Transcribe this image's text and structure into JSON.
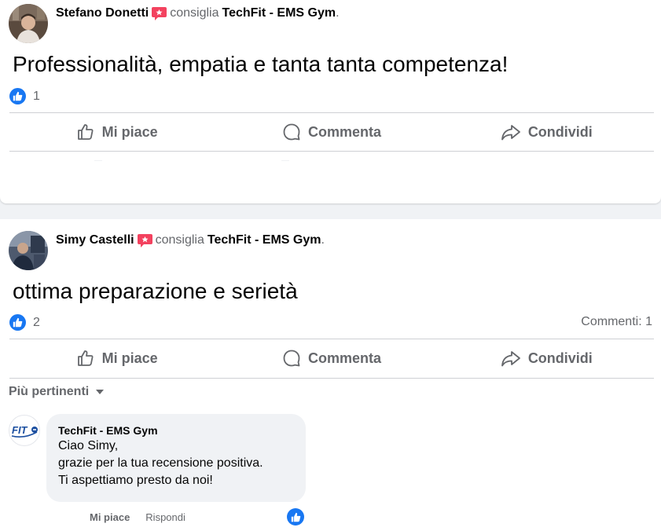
{
  "posts": [
    {
      "author": "Stefano Donetti",
      "verb": "consiglia",
      "page": "TechFit - EMS Gym",
      "text": "Professionalità, empatia e tanta tanta competenza!",
      "likes": "1"
    },
    {
      "author": "Simy Castelli",
      "verb": "consiglia",
      "page": "TechFit - EMS Gym",
      "text": "ottima preparazione e serietà",
      "likes": "2",
      "comments_count": "Commenti: 1"
    }
  ],
  "actions": {
    "like": "Mi piace",
    "comment": "Commenta",
    "share": "Condividi"
  },
  "sort_label": "Più pertinenti",
  "comment": {
    "author": "TechFit - EMS Gym",
    "lines": [
      "Ciao Simy,",
      "grazie per la tua recensione positiva.",
      "Ti aspettiamo presto da noi!"
    ],
    "like": "Mi piace",
    "reply": "Rispondi"
  },
  "page_logo_text": "FIT",
  "colors": {
    "accent": "#1877f2",
    "recommend": "#f3425f",
    "muted": "#65676b"
  },
  "icons": [
    "recommend-icon",
    "like-icon",
    "comment-icon",
    "share-icon",
    "chevron-down-icon"
  ]
}
